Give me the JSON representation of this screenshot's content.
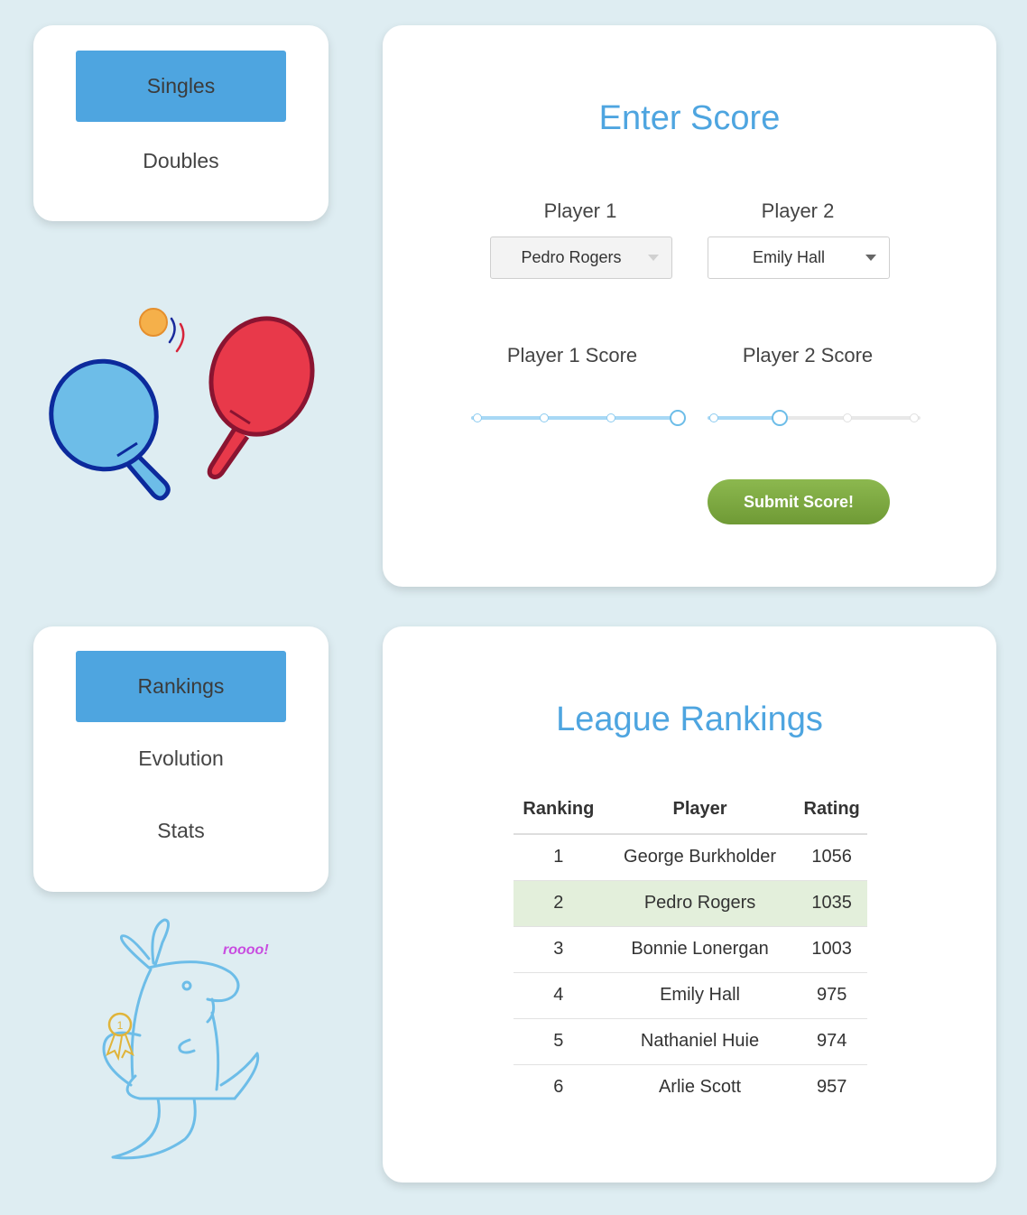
{
  "game_menu": {
    "items": [
      {
        "label": "Singles",
        "active": true
      },
      {
        "label": "Doubles",
        "active": false
      }
    ]
  },
  "view_menu": {
    "items": [
      {
        "label": "Rankings",
        "active": true
      },
      {
        "label": "Evolution",
        "active": false
      },
      {
        "label": "Stats",
        "active": false
      }
    ]
  },
  "score_form": {
    "title": "Enter Score",
    "player1_label": "Player 1",
    "player2_label": "Player 2",
    "player1_value": "Pedro Rogers",
    "player2_value": "Emily Hall",
    "player1_score_label": "Player 1 Score",
    "player2_score_label": "Player 2 Score",
    "player1_score_level": 1.0,
    "player2_score_level": 0.33,
    "submit_label": "Submit Score!"
  },
  "rankings": {
    "title": "League Rankings",
    "columns": [
      "Ranking",
      "Player",
      "Rating"
    ],
    "rows": [
      {
        "rank": "1",
        "player": "George Burkholder",
        "rating": "1056"
      },
      {
        "rank": "2",
        "player": "Pedro Rogers",
        "rating": "1035"
      },
      {
        "rank": "3",
        "player": "Bonnie Lonergan",
        "rating": "1003"
      },
      {
        "rank": "4",
        "player": "Emily Hall",
        "rating": "975"
      },
      {
        "rank": "5",
        "player": "Nathaniel Huie",
        "rating": "974"
      },
      {
        "rank": "6",
        "player": "Arlie Scott",
        "rating": "957"
      }
    ],
    "highlighted_row": 1
  },
  "kangaroo": {
    "caption": "roooo!",
    "medal": "1"
  },
  "colors": {
    "accent": "#4ea5e0",
    "submit": "#7ba842",
    "highlight_row": "#e3efdb",
    "background": "#deedf2"
  }
}
